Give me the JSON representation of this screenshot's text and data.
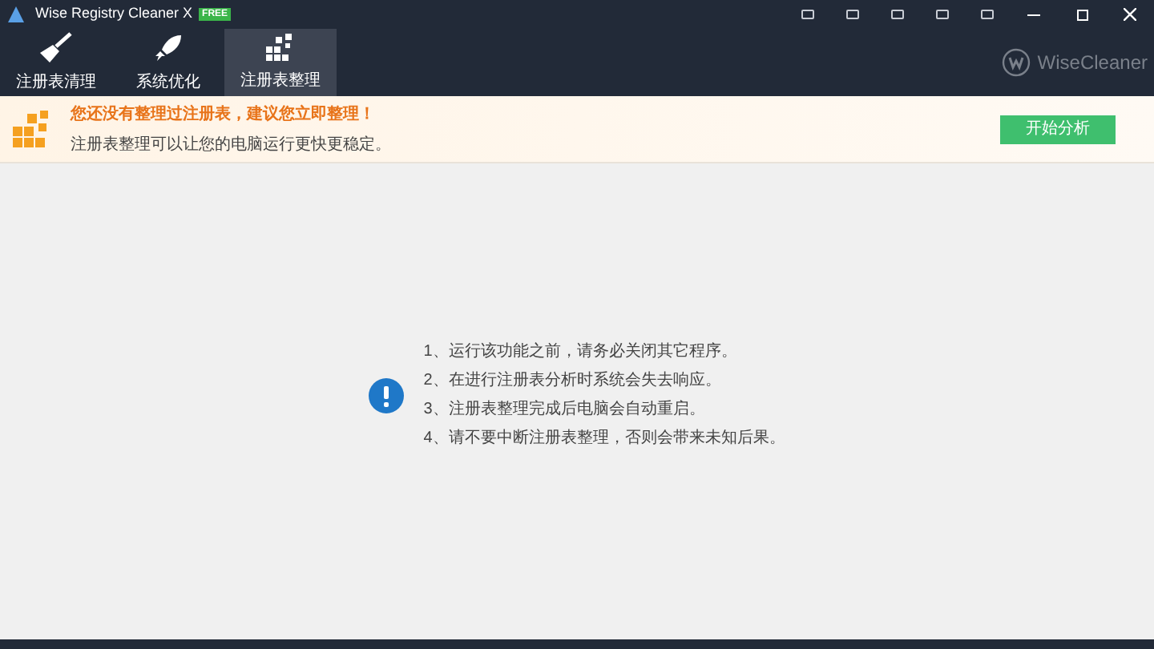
{
  "window": {
    "title": "Wise Registry Cleaner X",
    "badge": "FREE"
  },
  "tabs": [
    {
      "label": "注册表清理",
      "kind": "broom",
      "selected": false
    },
    {
      "label": "系统优化",
      "kind": "rocket",
      "selected": false
    },
    {
      "label": "注册表整理",
      "kind": "blocks",
      "selected": true
    }
  ],
  "brand": "WiseCleaner",
  "banner": {
    "title": "您还没有整理过注册表，建议您立即整理！",
    "subtitle": "注册表整理可以让您的电脑运行更快更稳定。",
    "button": "开始分析"
  },
  "notes": [
    "1、运行该功能之前，请务必关闭其它程序。",
    "2、在进行注册表分析时系统会失去响应。",
    "3、注册表整理完成后电脑会自动重启。",
    "4、请不要中断注册表整理，否则会带来未知后果。"
  ]
}
